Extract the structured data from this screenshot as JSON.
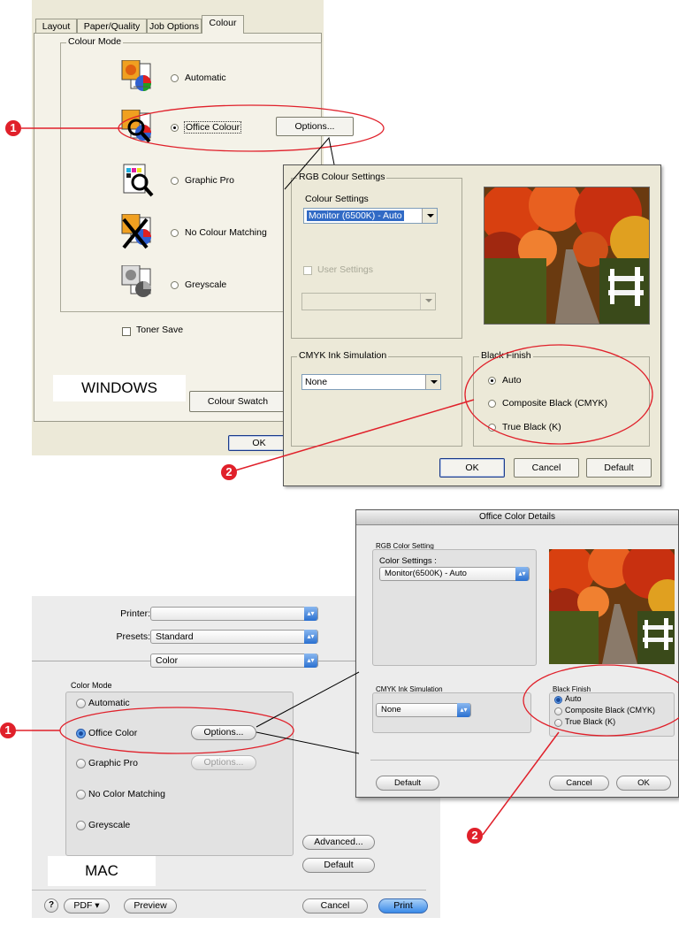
{
  "windows": {
    "tabs": [
      "Layout",
      "Paper/Quality",
      "Job Options",
      "Colour"
    ],
    "colour_mode_title": "Colour Mode",
    "modes": [
      {
        "label": "Automatic",
        "icon": "automatic-colour-icon"
      },
      {
        "label": "Office Colour",
        "icon": "office-colour-icon",
        "selected": true
      },
      {
        "label": "Graphic Pro",
        "icon": "graphic-pro-icon"
      },
      {
        "label": "No Colour Matching",
        "icon": "no-colour-matching-icon"
      },
      {
        "label": "Greyscale",
        "icon": "greyscale-icon"
      }
    ],
    "options_button": "Options...",
    "toner_save": "Toner Save",
    "platform_tag": "WINDOWS",
    "colour_swatch_button": "Colour Swatch",
    "ok_button": "OK"
  },
  "win_options": {
    "rgb_title": "RGB Colour Settings",
    "colour_settings_label": "Colour Settings",
    "colour_settings_value": "Monitor (6500K) - Auto",
    "user_settings": "User Settings",
    "cmyk_title": "CMYK Ink Simulation",
    "cmyk_value": "None",
    "black_finish_title": "Black Finish",
    "black_finish": [
      "Auto",
      "Composite Black (CMYK)",
      "True Black (K)"
    ],
    "ok": "OK",
    "cancel": "Cancel",
    "default": "Default"
  },
  "mac": {
    "printer_label": "Printer:",
    "printer_value": "",
    "presets_label": "Presets:",
    "presets_value": "Standard",
    "panel_value": "Color",
    "colour_mode_title": "Color Mode",
    "modes": [
      "Automatic",
      "Office Color",
      "Graphic Pro",
      "No Color Matching",
      "Greyscale"
    ],
    "options_button": "Options...",
    "platform_tag": "MAC",
    "advanced_button": "Advanced...",
    "default_button": "Default",
    "help": "?",
    "pdf_button": "PDF ▾",
    "preview_button": "Preview",
    "cancel_button": "Cancel",
    "print_button": "Print"
  },
  "mac_details": {
    "title": "Office Color Details",
    "rgb_title": "RGB Color Setting",
    "colour_settings_label": "Color Settings :",
    "colour_settings_value": "Monitor(6500K) - Auto",
    "cmyk_title": "CMYK Ink Simulation",
    "cmyk_value": "None",
    "black_finish_title": "Black Finish",
    "black_finish": [
      "Auto",
      "Composite Black (CMYK)",
      "True Black (K)"
    ],
    "default": "Default",
    "cancel": "Cancel",
    "ok": "OK"
  },
  "callouts": {
    "one": "1",
    "two": "2"
  },
  "colors": {
    "callout_red": "#e0202a",
    "win_face": "#ece9d8",
    "mac_face": "#ececec",
    "aqua_blue": "#3a8ae8"
  }
}
